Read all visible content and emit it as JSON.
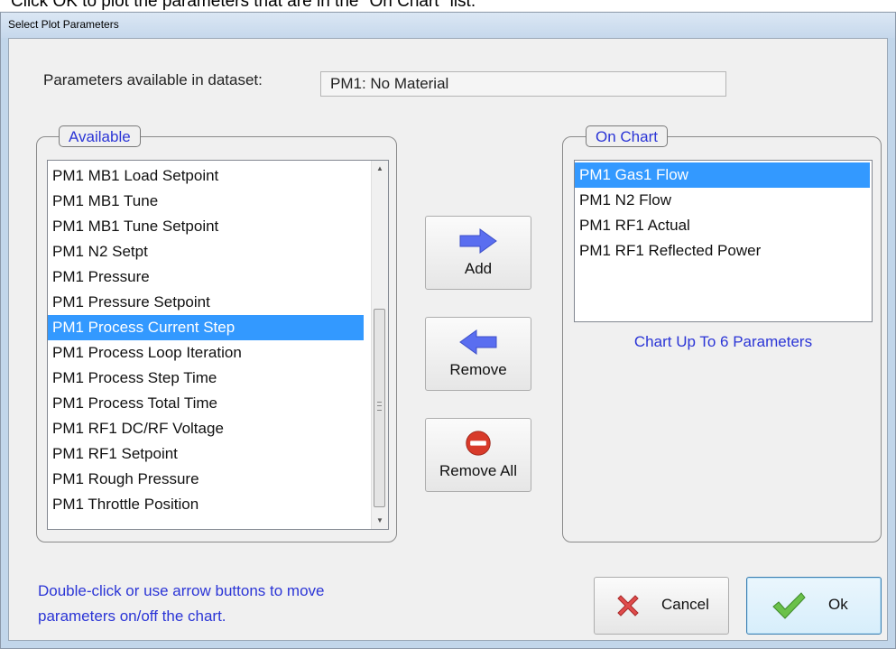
{
  "top_caption": "Click OK to plot the parameters that are in the \"On Chart\" list.",
  "window": {
    "title": "Select Plot Parameters"
  },
  "dataset": {
    "label": "Parameters available in dataset:",
    "value": "PM1: No Material"
  },
  "available": {
    "legend": "Available",
    "items": [
      "PM1 MB1 Load Setpoint",
      "PM1 MB1 Tune",
      "PM1 MB1 Tune Setpoint",
      "PM1 N2 Setpt",
      "PM1 Pressure",
      "PM1 Pressure Setpoint",
      "PM1 Process Current Step",
      "PM1 Process Loop Iteration",
      "PM1 Process Step Time",
      "PM1 Process Total Time",
      "PM1 RF1 DC/RF Voltage",
      "PM1 RF1 Setpoint",
      "PM1 Rough Pressure",
      "PM1 Throttle Position"
    ],
    "selected_index": 6
  },
  "on_chart": {
    "legend": "On Chart",
    "items": [
      "PM1 Gas1 Flow",
      "PM1 N2 Flow",
      "PM1 RF1 Actual",
      "PM1 RF1 Reflected Power"
    ],
    "selected_index": 0,
    "note": "Chart Up To 6 Parameters"
  },
  "buttons": {
    "add": {
      "label": "Add",
      "icon": "arrow-right-icon"
    },
    "remove": {
      "label": "Remove",
      "icon": "arrow-left-icon"
    },
    "remove_all": {
      "label": "Remove All",
      "icon": "no-entry-icon"
    },
    "cancel": {
      "label": "Cancel",
      "icon": "red-x-icon"
    },
    "ok": {
      "label": "Ok",
      "icon": "green-check-icon"
    }
  },
  "hint": {
    "line1": "Double-click or use arrow buttons to move",
    "line2": "parameters on/off the chart."
  },
  "colors": {
    "accent_text": "#2b35d6",
    "selection": "#3399ff",
    "arrow": "#5a6ef0"
  }
}
